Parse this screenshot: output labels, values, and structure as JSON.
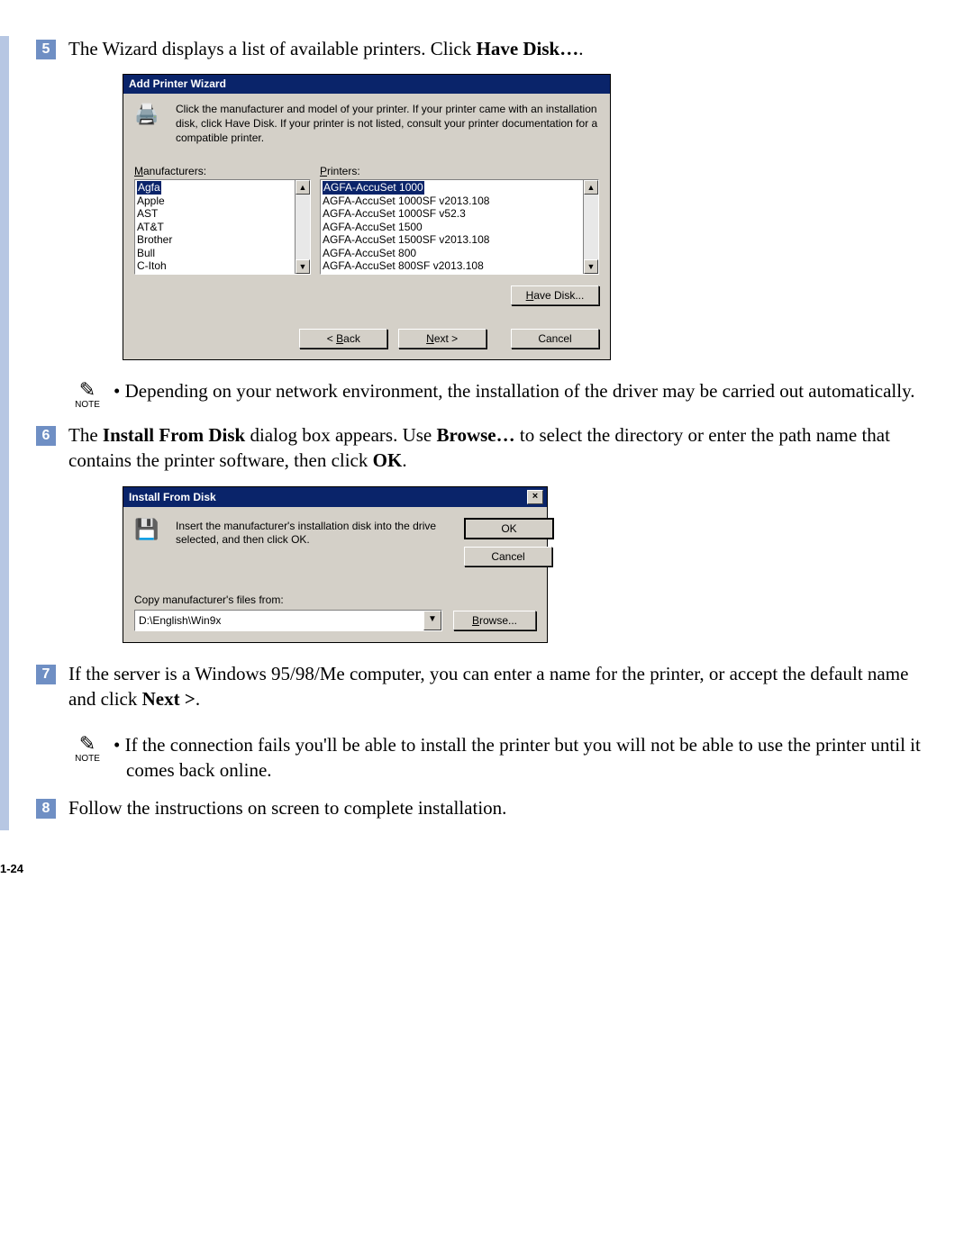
{
  "steps": {
    "5": {
      "num": "5",
      "pre": "The Wizard displays a list of available printers. Click ",
      "bold": "Have Disk…",
      "post": "."
    },
    "6": {
      "num": "6",
      "p1": "The ",
      "b1": "Install From Disk",
      "p2": " dialog box appears. Use ",
      "b2": "Browse…",
      "p3": " to select the directory or enter the path name that contains the printer software, then click ",
      "b3": "OK",
      "p4": "."
    },
    "7": {
      "num": "7",
      "p1": "If the server is a Windows 95/98/Me computer, you can enter a name for the printer, or accept the default name and click ",
      "b1": "Next >",
      "p2": "."
    },
    "8": {
      "num": "8",
      "text": "Follow the instructions on screen to complete installation."
    }
  },
  "notes": {
    "noteLabel": "NOTE",
    "note1": "•  Depending on your network environment, the installation of the driver may be carried out automatically.",
    "note2": "•  If the connection fails you'll be able to install the printer but you will not be able to use the printer until it comes back online."
  },
  "wizard": {
    "title": "Add Printer Wizard",
    "intro": "Click the manufacturer and model of your printer. If your printer came with an installation disk, click Have Disk. If your printer is not listed, consult your printer documentation for a compatible printer.",
    "manLabelU": "M",
    "manLabelRest": "anufacturers:",
    "prnLabelU": "P",
    "prnLabelRest": "rinters:",
    "manufacturers": [
      "Agfa",
      "Apple",
      "AST",
      "AT&T",
      "Brother",
      "Bull",
      "C-Itoh"
    ],
    "printers": [
      "AGFA-AccuSet 1000",
      "AGFA-AccuSet 1000SF v2013.108",
      "AGFA-AccuSet 1000SF v52.3",
      "AGFA-AccuSet 1500",
      "AGFA-AccuSet 1500SF v2013.108",
      "AGFA-AccuSet 800",
      "AGFA-AccuSet 800SF v2013.108"
    ],
    "haveDiskU": "H",
    "haveDiskRest": "ave Disk...",
    "backLt": "< ",
    "backU": "B",
    "backRest": "ack",
    "nextU": "N",
    "nextRest": "ext >",
    "cancel": "Cancel"
  },
  "ifd": {
    "title": "Install From Disk",
    "close": "×",
    "insertText": "Insert the manufacturer's installation disk into the drive selected, and then click OK.",
    "ok": "OK",
    "cancel": "Cancel",
    "copyLabel": "Copy manufacturer's files from:",
    "path": "D:\\English\\Win9x",
    "browseU": "B",
    "browseRest": "rowse..."
  },
  "pageNumber": "1-24"
}
